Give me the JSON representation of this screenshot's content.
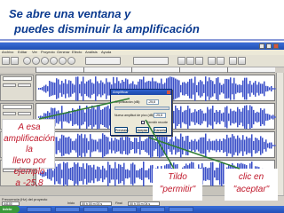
{
  "slide": {
    "title_line1": "Se abre una ventana y",
    "title_line2": "puedes disminuir la amplificación"
  },
  "audacity": {
    "menu": [
      "Archivo",
      "Editar",
      "Ver",
      "Proyecto",
      "Generar",
      "Efecto",
      "Análisis",
      "Ayuda"
    ],
    "selection_bar": {
      "rate_label": "Frecuencia (Hz) del proyecto",
      "rate_value": "44100",
      "start_caption": "Inicio",
      "start_value": "00 h 00 m 00 s",
      "end_caption": "Final",
      "end_value": "00 h 03 m 04 s"
    },
    "taskbar": {
      "start_label": "Inicio"
    }
  },
  "dialog": {
    "title": "Amplificar",
    "amplification_label": "Amplificación (dB):",
    "amplification_value": "-25,8",
    "peak_label": "Nueva amplitud de pico (dB):",
    "peak_value": "-25,8",
    "allow_clipping_label": "Permitir recorte",
    "buttons": [
      "Previsión",
      "Aceptar",
      "Cancelar"
    ]
  },
  "callouts": {
    "left": [
      "A esa",
      "amplificación la",
      "llevo por ejemplo",
      "a -25,8"
    ],
    "middle": [
      "Tildo",
      "\"permitir\""
    ],
    "right": [
      "clic en",
      "\"aceptar\""
    ]
  },
  "colors": {
    "title_text": "#0b3a8f",
    "callout_text": "#c0182b",
    "waveform": "#3a4fc8",
    "arrow": "#2e7d32"
  }
}
